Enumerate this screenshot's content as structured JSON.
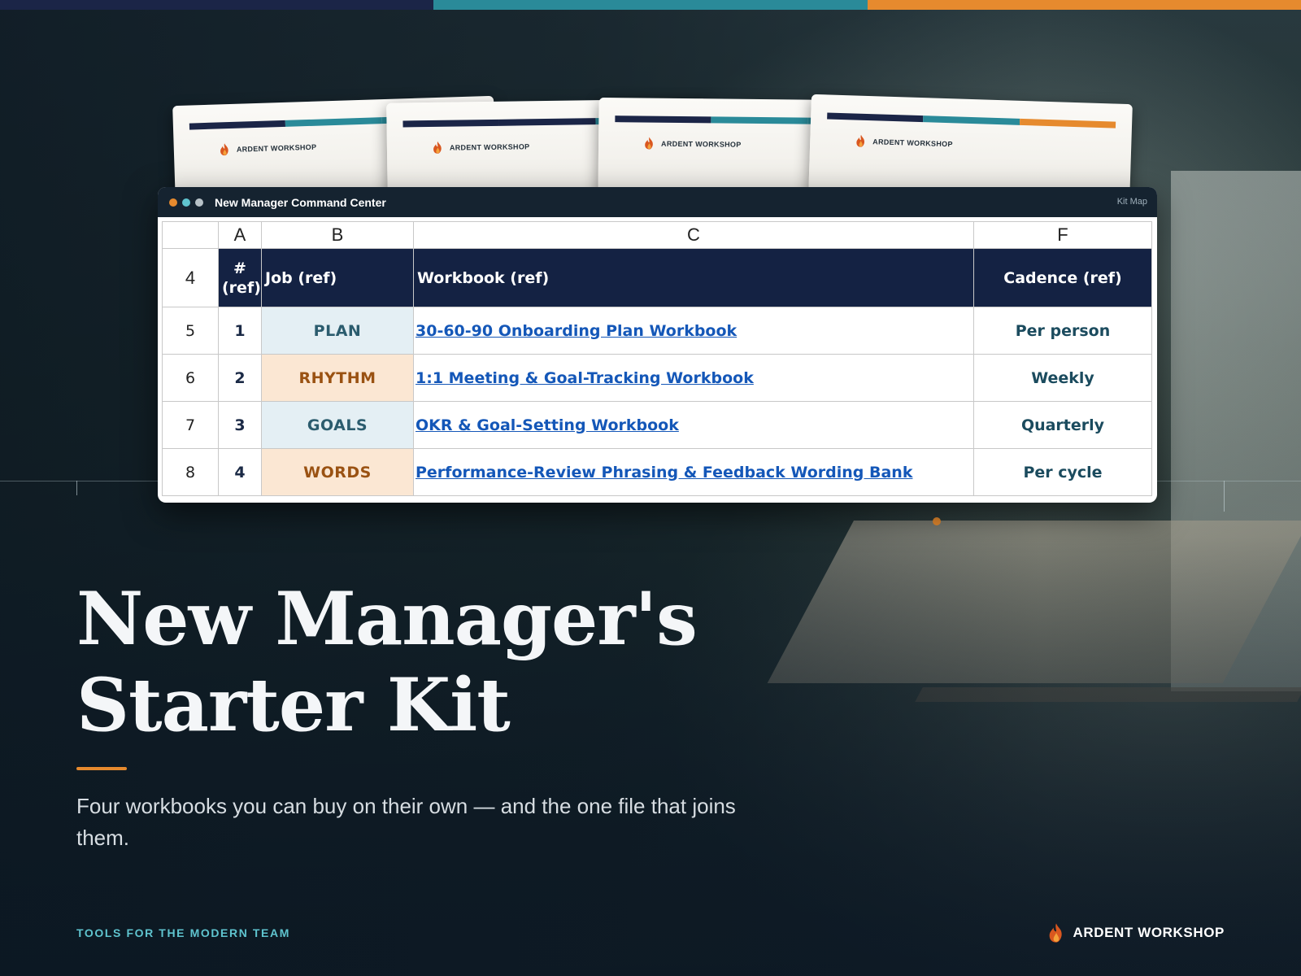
{
  "colors": {
    "navy": "#1b2547",
    "teal": "#2a8a99",
    "orange": "#e68a2e",
    "accent": "#e68a2e"
  },
  "kit_cards": [
    {
      "brand": "ARDENT WORKSHOP",
      "icon": "flame-icon"
    },
    {
      "brand": "ARDENT WORKSHOP",
      "icon": "flame-icon"
    },
    {
      "brand": "ARDENT WORKSHOP",
      "icon": "flame-icon"
    },
    {
      "brand": "ARDENT WORKSHOP",
      "icon": "flame-icon"
    }
  ],
  "window": {
    "title": "New Manager Command Center",
    "tab_label": "Kit Map"
  },
  "sheet": {
    "columns": [
      "A",
      "B",
      "C",
      "F"
    ],
    "header_row_number": "4",
    "headers": [
      "# (ref)",
      "Job (ref)",
      "Workbook (ref)",
      "Cadence (ref)"
    ],
    "rows": [
      {
        "row": "5",
        "num": "1",
        "job": "PLAN",
        "workbook": "30-60-90 Onboarding Plan Workbook",
        "cadence": "Per person"
      },
      {
        "row": "6",
        "num": "2",
        "job": "RHYTHM",
        "workbook": "1:1 Meeting & Goal-Tracking Workbook",
        "cadence": "Weekly"
      },
      {
        "row": "7",
        "num": "3",
        "job": "GOALS",
        "workbook": "OKR & Goal-Setting Workbook",
        "cadence": "Quarterly"
      },
      {
        "row": "8",
        "num": "4",
        "job": "WORDS",
        "workbook": "Performance-Review Phrasing & Feedback Wording Bank",
        "cadence": "Per cycle"
      }
    ]
  },
  "hero": {
    "title_line1": "New Manager's",
    "title_line2": "Starter Kit",
    "subtitle": "Four workbooks you can buy on their own — and the one file that joins them."
  },
  "footer": {
    "tagline": "TOOLS FOR THE MODERN TEAM",
    "brand": "ARDENT WORKSHOP"
  }
}
